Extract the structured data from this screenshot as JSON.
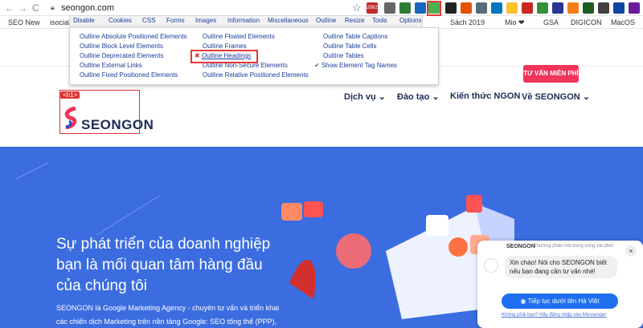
{
  "browser": {
    "url": "seongon.com",
    "nav_back": "←",
    "nav_forward": "→",
    "reload": "C"
  },
  "extensions": {
    "badge_count": "2082",
    "badge_count2": "5",
    "badge_count3": "34"
  },
  "bookmarks": [
    "SEO New",
    "isocial",
    "Sách 2019",
    "Mio ❤",
    "GSA",
    "DIGICON",
    "MacOS"
  ],
  "web_developer_toolbar": {
    "items": [
      "Disable",
      "Cookies",
      "CSS",
      "Forms",
      "Images",
      "Information",
      "Miscellaneous",
      "Outline",
      "Resize",
      "Tools",
      "Options"
    ]
  },
  "outline_menu": {
    "col1": [
      "Outline Absolute Positioned Elements",
      "Outline Block Level Elements",
      "Outline Deprecated Elements",
      "Outline External Links",
      "Outline Fixed Positioned Elements"
    ],
    "col2": [
      "Outline Floated Elements",
      "Outline Frames",
      "Outline Headings",
      "Outline Non-Secure Elements",
      "Outline Relative Positioned Elements"
    ],
    "col3": [
      "Outline Table Captions",
      "Outline Table Cells",
      "Outline Tables",
      "Show Element Tag Names"
    ],
    "checked_item": "Outline Headings",
    "checked_item2": "Show Element Tag Names"
  },
  "site": {
    "h1_tag": "<h1>",
    "logo": "SEONGON",
    "cta": "TƯ VẤN MIỄN PHÍ",
    "nav": [
      "Dịch vụ",
      "Đào tạo",
      "Kiến thức NGON",
      "Về SEONGON"
    ],
    "hero_title": "Sự phát triển của doanh nghiệp bạn là mối quan tâm hàng đầu của chúng tôi",
    "hero_desc_1": "SEONGON là Google Marketing Agency - chuyên tư vấn và triển khai",
    "hero_desc_2": "các chiến dịch Marketing trên nền tảng Google: SEO tổng thể (PPP),"
  },
  "chat": {
    "brand": "SEONGON",
    "subtitle": "Thường phản hồi trong vòng vài phút",
    "message": "Xin chào! Nói cho SEONGON biết nếu bạn đang cần tư vấn nhé!",
    "button": "Tiếp tục dưới tên Hà Việt",
    "link": "Không phải bạn? Hãy đăng nhập vào Messenger",
    "close": "×"
  },
  "colors": {
    "hero_bg": "#3b6de0",
    "cta_bg": "#f0345a",
    "highlight": "#e53935",
    "link": "#1a3c9a"
  }
}
